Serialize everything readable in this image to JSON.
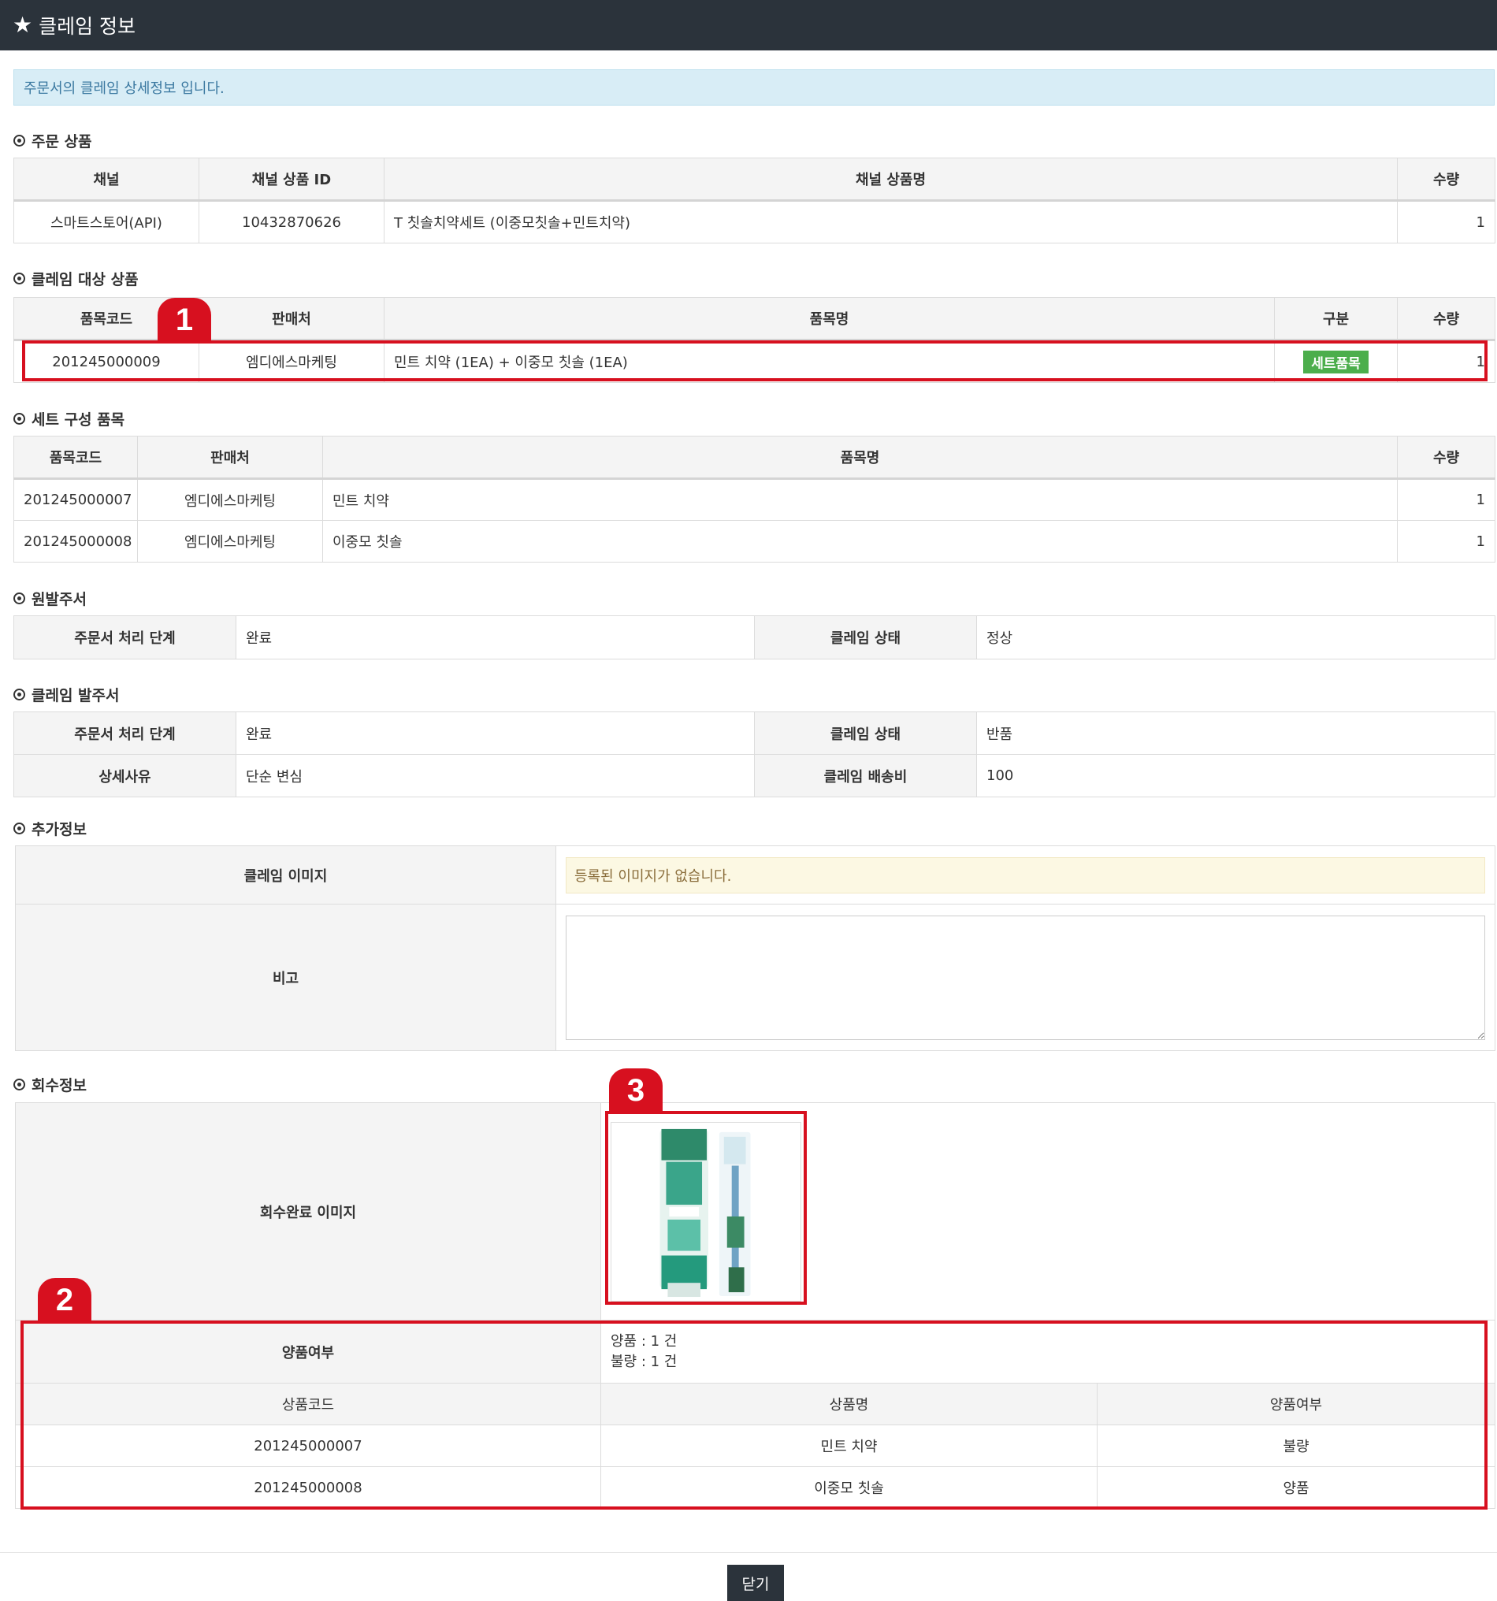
{
  "header": {
    "title": "클레임 정보"
  },
  "notice": "주문서의 클레임 상세정보 입니다.",
  "order_products": {
    "label": "주문 상품",
    "columns": [
      "채널",
      "채널 상품 ID",
      "채널 상품명",
      "수량"
    ],
    "rows": [
      [
        "스마트스토어(API)",
        "10432870626",
        "T 칫솔치약세트 (이중모칫솔+민트치약)",
        "1"
      ]
    ]
  },
  "claim_target": {
    "label": "클레임 대상 상품",
    "columns": [
      "품목코드",
      "판매처",
      "품목명",
      "구분",
      "수량"
    ],
    "rows": [
      [
        "201245000009",
        "엠디에스마케팅",
        "민트 치약 (1EA) + 이중모 칫솔 (1EA)",
        "세트품목",
        "1"
      ]
    ]
  },
  "set_items": {
    "label": "세트 구성 품목",
    "columns": [
      "품목코드",
      "판매처",
      "품목명",
      "수량"
    ],
    "rows": [
      [
        "201245000007",
        "엠디에스마케팅",
        "민트 치약",
        "1"
      ],
      [
        "201245000008",
        "엠디에스마케팅",
        "이중모 칫솔",
        "1"
      ]
    ]
  },
  "original_order": {
    "label": "원발주서",
    "stage_label": "주문서 처리 단계",
    "stage_value": "완료",
    "status_label": "클레임 상태",
    "status_value": "정상"
  },
  "claim_order": {
    "label": "클레임 발주서",
    "stage_label": "주문서 처리 단계",
    "stage_value": "완료",
    "status_label": "클레임 상태",
    "status_value": "반품",
    "reason_label": "상세사유",
    "reason_value": "단순 변심",
    "fee_label": "클레임 배송비",
    "fee_value": "100"
  },
  "extra_info": {
    "label": "추가정보",
    "image_label": "클레임 이미지",
    "image_empty": "등록된 이미지가 없습니다.",
    "memo_label": "비고"
  },
  "recovery": {
    "label": "회수정보",
    "image_label": "회수완료 이미지",
    "quality_label": "양품여부",
    "good_summary": "양품 : 1 건",
    "bad_summary": "불량 : 1 건",
    "columns": [
      "상품코드",
      "상품명",
      "양품여부"
    ],
    "rows": [
      [
        "201245000007",
        "민트 치약",
        "불량"
      ],
      [
        "201245000008",
        "이중모 칫솔",
        "양품"
      ]
    ]
  },
  "markers": [
    "1",
    "2",
    "3"
  ],
  "close_label": "닫기",
  "colors": {
    "header_bg": "#2b333b",
    "accent_red": "#d7101f",
    "badge_green": "#4cae4c"
  }
}
